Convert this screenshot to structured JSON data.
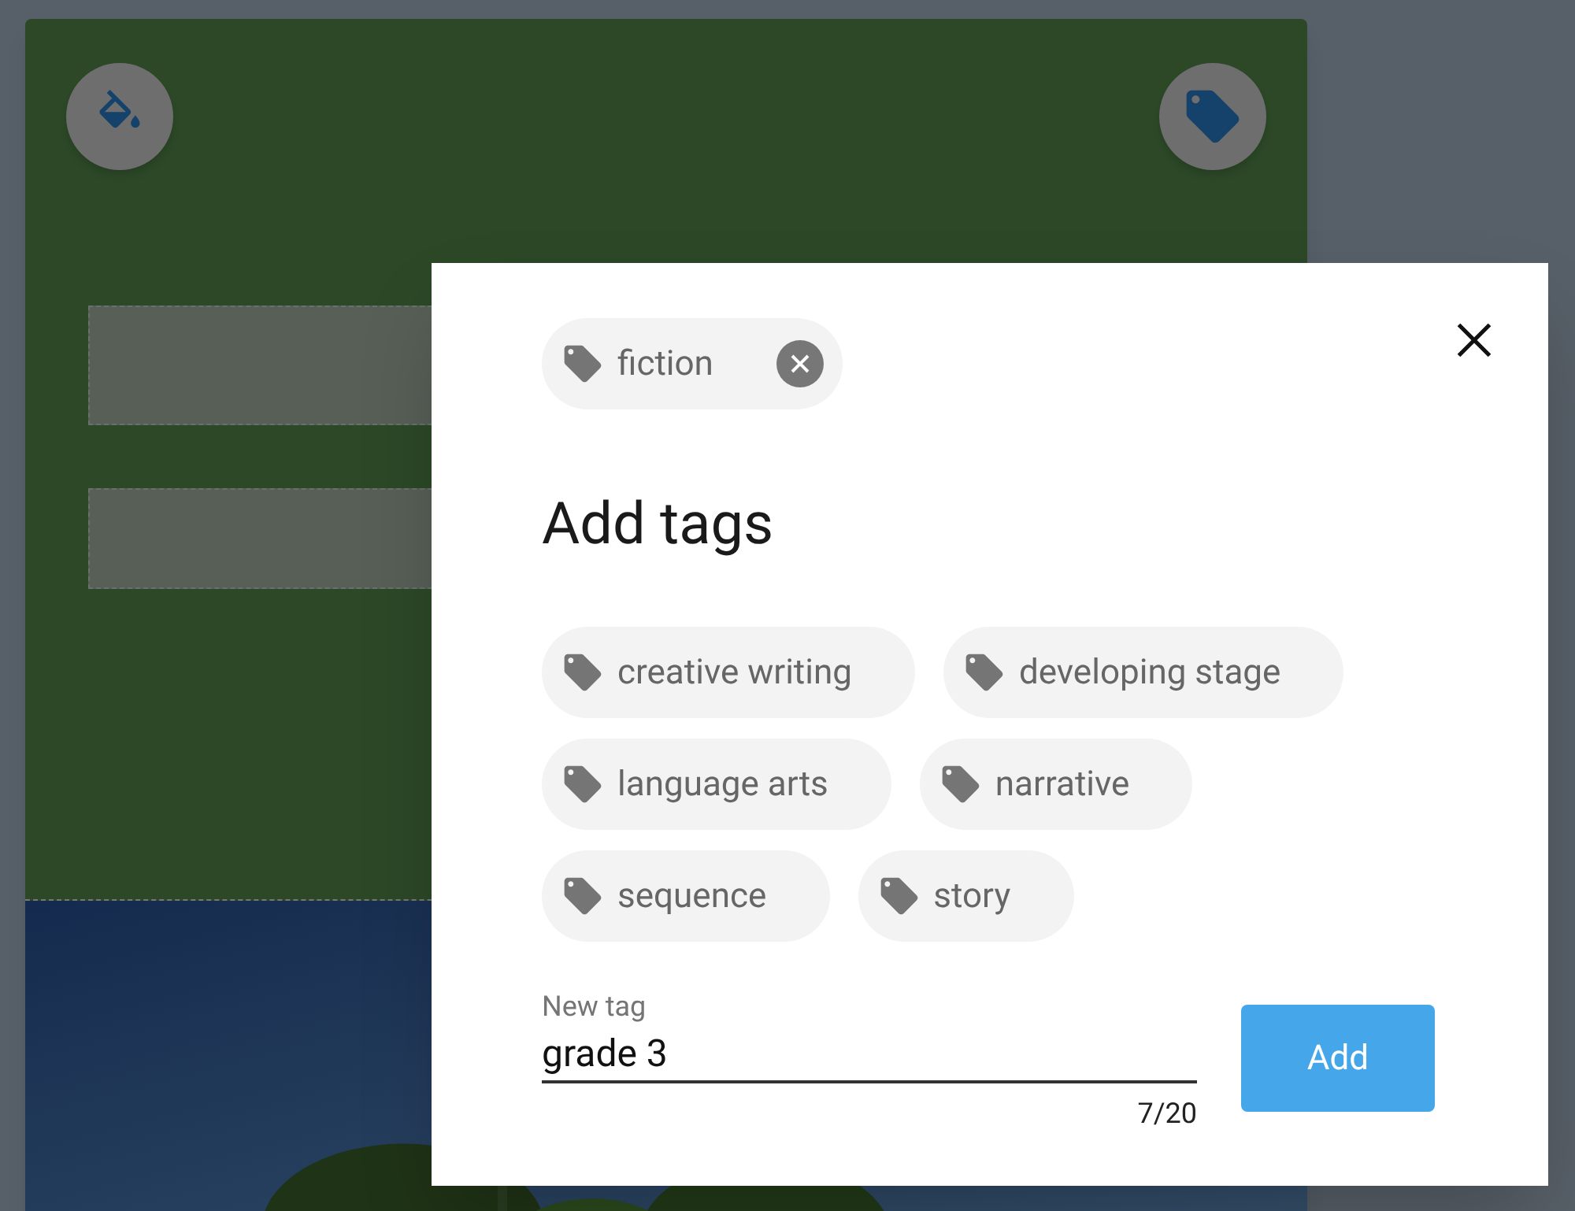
{
  "applied_tags": [
    {
      "label": "fiction"
    }
  ],
  "dialog": {
    "title": "Add tags"
  },
  "suggested_tags": [
    {
      "label": "creative writing"
    },
    {
      "label": "developing stage"
    },
    {
      "label": "language arts"
    },
    {
      "label": "narrative"
    },
    {
      "label": "sequence"
    },
    {
      "label": "story"
    }
  ],
  "new_tag": {
    "label": "New tag",
    "value": "grade 3",
    "counter": "7/20"
  },
  "add_button": {
    "label": "Add"
  }
}
